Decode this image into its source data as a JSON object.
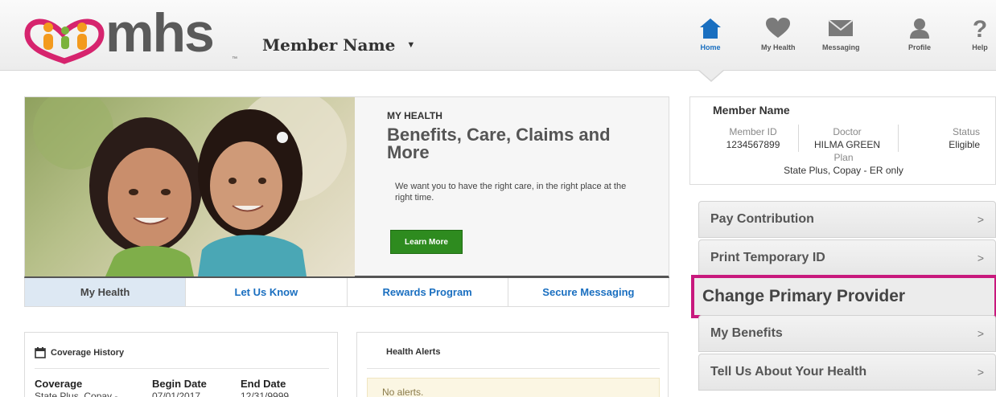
{
  "header": {
    "logo_text": "mhs",
    "member_name": "Member Name",
    "nav": [
      {
        "label": "Home",
        "icon": "home-icon",
        "active": true
      },
      {
        "label": "My Health",
        "icon": "heart-icon",
        "active": false
      },
      {
        "label": "Messaging",
        "icon": "envelope-icon",
        "active": false
      },
      {
        "label": "Profile",
        "icon": "user-icon",
        "active": false
      },
      {
        "label": "Help",
        "icon": "question-icon",
        "active": false
      }
    ]
  },
  "hero": {
    "eyebrow": "MY HEALTH",
    "title": "Benefits, Care, Claims and More",
    "text": "We want you to have the right care, in the right place at the right time.",
    "button": "Learn More"
  },
  "tabs": [
    {
      "label": "My Health",
      "active": true
    },
    {
      "label": "Let Us Know",
      "active": false
    },
    {
      "label": "Rewards Program",
      "active": false
    },
    {
      "label": "Secure Messaging",
      "active": false
    }
  ],
  "coverage": {
    "title": "Coverage History",
    "headers": [
      "Coverage",
      "Begin Date",
      "End Date"
    ],
    "rows": [
      [
        "State Plus, Copay -",
        "07/01/2017",
        "12/31/9999"
      ]
    ]
  },
  "alerts": {
    "title": "Health Alerts",
    "message": "No alerts."
  },
  "member_card": {
    "name": "Member Name",
    "member_id_label": "Member ID",
    "member_id": "1234567899",
    "doctor_label": "Doctor",
    "doctor": "HILMA GREEN",
    "status_label": "Status",
    "status": "Eligible",
    "plan_label": "Plan",
    "plan": "State Plus, Copay - ER only"
  },
  "actions": [
    {
      "label": "Pay Contribution",
      "arrow": ">"
    },
    {
      "label": "Print Temporary ID",
      "arrow": ">"
    },
    {
      "label": "Change Primary Provider",
      "arrow": "",
      "highlight": true
    },
    {
      "label": "My Benefits",
      "arrow": ">"
    },
    {
      "label": "Tell Us About Your Health",
      "arrow": ">"
    }
  ],
  "colors": {
    "accent_blue": "#1a6fc0",
    "button_green": "#2e8b1f",
    "highlight_magenta": "#c8197d",
    "logo_orange": "#f39a1e",
    "logo_pink": "#d6246e"
  }
}
